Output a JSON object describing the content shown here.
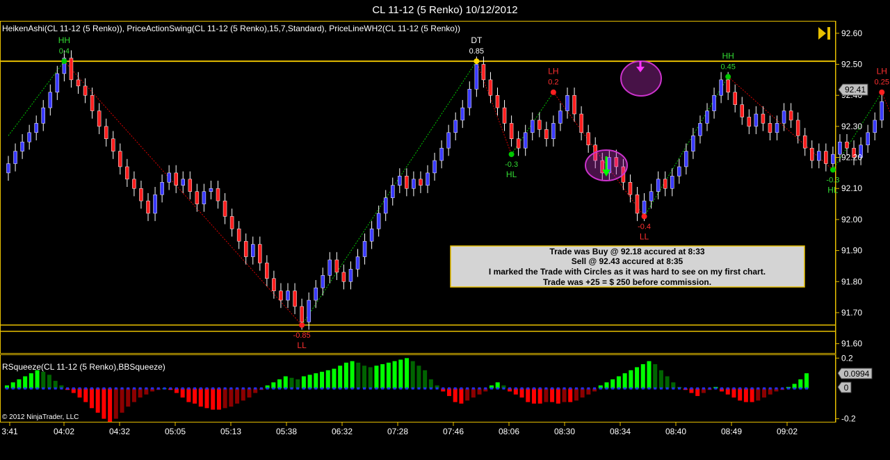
{
  "window_title": "CL 11-12 (5 Renko)  10/12/2012",
  "price_panel": {
    "indicator_label": "HeikenAshi(CL 11-12 (5 Renko)), PriceActionSwing(CL 11-12 (5 Renko),15,7,Standard), PriceLineWH2(CL 11-12 (5 Renko))",
    "play_icon": "skip-forward-icon"
  },
  "squeeze_panel": {
    "label": "RSqueeze(CL 11-12 (5 Renko),BBSqueeze)",
    "copyright": "© 2012 NinjaTrader, LLC"
  },
  "annotation": {
    "lines": [
      "Trade was  Buy @ 92.18 accured at 8:33",
      "Sell @ 92.43 accured at 8:35",
      "I marked the Trade with Circles as it was hard to see on my first chart.",
      "Trade was +25 = $ 250 before commission."
    ]
  },
  "colors": {
    "up_bar": "#3a3aff",
    "down_bar": "#ff1e1e",
    "swing_up": "#00c800",
    "swing_down": "#d80000",
    "level_line": "#e8c000",
    "squeeze_up_strong": "#00ff00",
    "squeeze_up_weak": "#006400",
    "squeeze_down_strong": "#ff0000",
    "squeeze_down_weak": "#8b0000",
    "squeeze_dot": "#2030ff",
    "circle": "#cc33cc"
  },
  "chart_data": [
    {
      "type": "candlestick",
      "title": "CL 11-12 (5 Renko)  10/12/2012",
      "y_ticks": [
        "92.60",
        "92.50",
        "92.40",
        "92.30",
        "92.20",
        "92.10",
        "92.00",
        "91.90",
        "91.80",
        "91.70",
        "91.60"
      ],
      "ylim": [
        91.57,
        92.64
      ],
      "x_ticks": [
        "3:41",
        "04:02",
        "04:32",
        "05:05",
        "05:13",
        "05:38",
        "06:32",
        "07:28",
        "07:46",
        "08:06",
        "08:30",
        "08:34",
        "08:40",
        "08:49",
        "09:02"
      ],
      "last_price": "92.41",
      "horizontal_levels": [
        92.51,
        91.66,
        91.64
      ],
      "candle_closes": [
        92.18,
        92.22,
        92.25,
        92.28,
        92.31,
        92.36,
        92.41,
        92.47,
        92.52,
        92.45,
        92.43,
        92.4,
        92.35,
        92.3,
        92.26,
        92.22,
        92.17,
        92.13,
        92.1,
        92.06,
        92.02,
        92.08,
        92.12,
        92.15,
        92.11,
        92.13,
        92.09,
        92.05,
        92.09,
        92.1,
        92.06,
        92.01,
        91.97,
        91.93,
        91.88,
        91.92,
        91.86,
        91.81,
        91.77,
        91.74,
        91.77,
        91.72,
        91.67,
        91.74,
        91.78,
        91.82,
        91.87,
        91.83,
        91.8,
        91.84,
        91.88,
        91.93,
        91.97,
        92.02,
        92.07,
        92.11,
        92.14,
        92.1,
        92.13,
        92.11,
        92.15,
        92.19,
        92.23,
        92.28,
        92.32,
        92.36,
        92.42,
        92.5,
        92.45,
        92.4,
        92.36,
        92.31,
        92.26,
        92.23,
        92.28,
        92.32,
        92.29,
        92.26,
        92.31,
        92.35,
        92.4,
        92.34,
        92.28,
        92.24,
        92.19,
        92.15,
        92.2,
        92.17,
        92.12,
        92.08,
        92.02,
        92.06,
        92.09,
        92.13,
        92.1,
        92.14,
        92.17,
        92.22,
        92.27,
        92.31,
        92.35,
        92.4,
        92.45,
        92.41,
        92.37,
        92.33,
        92.3,
        92.34,
        92.31,
        92.28,
        92.31,
        92.35,
        92.32,
        92.27,
        92.23,
        92.19,
        92.22,
        92.18,
        92.21,
        92.25,
        92.23,
        92.2,
        92.24,
        92.28,
        92.32,
        92.38
      ]
    },
    {
      "type": "line",
      "name": "PriceActionSwing",
      "swing_points": [
        {
          "x": 0,
          "y": 92.27
        },
        {
          "x": 8,
          "y": 92.51,
          "tag": "HH",
          "value": "0.4"
        },
        {
          "x": 42,
          "y": 91.66,
          "tag": "LL",
          "value": "-0.85"
        },
        {
          "x": 67,
          "y": 92.51,
          "tag": "DT",
          "value": "0.85"
        },
        {
          "x": 72,
          "y": 92.21,
          "tag": "HL",
          "value": "-0.3"
        },
        {
          "x": 78,
          "y": 92.41,
          "tag": "LH",
          "value": "0.2"
        },
        {
          "x": 91,
          "y": 92.01,
          "tag": "LL",
          "value": "-0.4"
        },
        {
          "x": 103,
          "y": 92.46,
          "tag": "HH",
          "value": "0.45"
        },
        {
          "x": 118,
          "y": 92.16,
          "tag": "HL",
          "value": "-0.3"
        },
        {
          "x": 125,
          "y": 92.41,
          "tag": "LH",
          "value": "0.25"
        },
        {
          "x": 129,
          "y": 92.19
        }
      ]
    },
    {
      "type": "bar",
      "name": "RSqueeze",
      "y_ticks": [
        "0.2",
        "-0.2"
      ],
      "ylim": [
        -0.22,
        0.22
      ],
      "last_value": "0.0994",
      "zero_label": "0",
      "values": [
        0.02,
        0.04,
        0.06,
        0.08,
        0.1,
        0.12,
        0.11,
        0.09,
        0.05,
        0.02,
        -0.01,
        -0.03,
        -0.06,
        -0.09,
        -0.13,
        -0.16,
        -0.2,
        -0.22,
        -0.2,
        -0.16,
        -0.12,
        -0.09,
        -0.06,
        -0.04,
        -0.02,
        -0.01,
        0.0,
        -0.01,
        -0.03,
        -0.06,
        -0.09,
        -0.1,
        -0.12,
        -0.13,
        -0.14,
        -0.14,
        -0.13,
        -0.12,
        -0.1,
        -0.08,
        -0.06,
        -0.03,
        -0.01,
        0.02,
        0.04,
        0.06,
        0.08,
        0.07,
        0.06,
        0.08,
        0.09,
        0.1,
        0.11,
        0.12,
        0.13,
        0.15,
        0.17,
        0.18,
        0.17,
        0.15,
        0.14,
        0.15,
        0.16,
        0.17,
        0.18,
        0.19,
        0.2,
        0.18,
        0.15,
        0.12,
        0.06,
        0.02,
        -0.02,
        -0.05,
        -0.09,
        -0.1,
        -0.08,
        -0.06,
        -0.04,
        -0.02,
        0.02,
        0.04,
        0.02,
        -0.02,
        -0.04,
        -0.06,
        -0.09,
        -0.1,
        -0.1,
        -0.09,
        -0.09,
        -0.1,
        -0.09,
        -0.09,
        -0.08,
        -0.06,
        -0.04,
        -0.02,
        0.02,
        0.04,
        0.06,
        0.08,
        0.1,
        0.12,
        0.14,
        0.16,
        0.18,
        0.16,
        0.12,
        0.08,
        0.04,
        0.01,
        -0.01,
        -0.03,
        -0.05,
        -0.03,
        -0.01,
        0.01,
        -0.02,
        -0.04,
        -0.06,
        -0.08,
        -0.09,
        -0.09,
        -0.08,
        -0.06,
        -0.04,
        -0.02,
        -0.01,
        0.01,
        0.03,
        0.06,
        0.1
      ]
    }
  ]
}
